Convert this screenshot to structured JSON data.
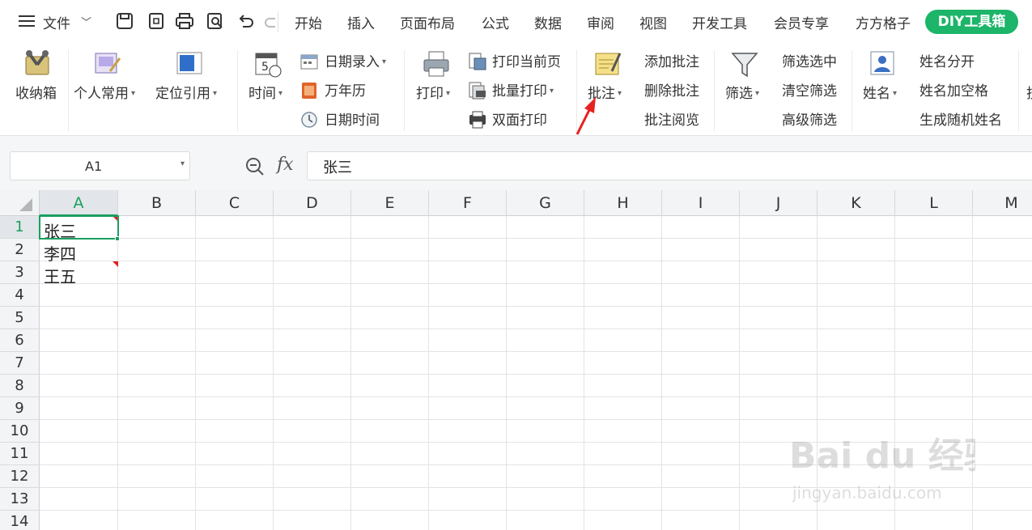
{
  "menubar": {
    "hamburger_icon": "menu-icon",
    "file_label": "文件",
    "tabs": [
      "开始",
      "插入",
      "页面布局",
      "公式",
      "数据",
      "审阅",
      "视图",
      "开发工具",
      "会员专享",
      "方方格子"
    ],
    "diy_tab": "DIY工具箱"
  },
  "ribbon": {
    "shoubox": "收纳箱",
    "personal": "个人常用",
    "locate": "定位引用",
    "time": "时间",
    "date_entry": "日期录入",
    "calendar": "万年历",
    "datetime": "日期时间",
    "print": "打印",
    "print_current": "打印当前页",
    "batch_print": "批量打印",
    "duplex_print": "双面打印",
    "comment": "批注",
    "add_comment": "添加批注",
    "delete_comment": "删除批注",
    "view_comment": "批注阅览",
    "filter": "筛选",
    "filter_selected": "筛选选中",
    "clear_filter": "清空筛选",
    "advanced_filter": "高级筛选",
    "name": "姓名",
    "split_name": "姓名分开",
    "name_space": "姓名加空格",
    "random_name": "生成随机姓名",
    "overflow": "技"
  },
  "formula_bar": {
    "cell_ref": "A1",
    "fx": "fx",
    "content": "张三"
  },
  "columns": [
    "A",
    "B",
    "C",
    "D",
    "E",
    "F",
    "G",
    "H",
    "I",
    "J",
    "K",
    "L",
    "M"
  ],
  "rows": [
    "1",
    "2",
    "3",
    "4",
    "5",
    "6",
    "7",
    "8",
    "9",
    "10",
    "11",
    "12",
    "13",
    "14"
  ],
  "cells": {
    "A1": "张三",
    "A2": "李四",
    "A3": "王五"
  },
  "colors": {
    "diy_green": "#1cb569",
    "selection_green": "#1a9f5f",
    "comment_marker": "#e02020",
    "arrow_red": "#e82020"
  },
  "watermark": {
    "brand": "Bai du 经验",
    "url": "jingyan.baidu.com"
  }
}
